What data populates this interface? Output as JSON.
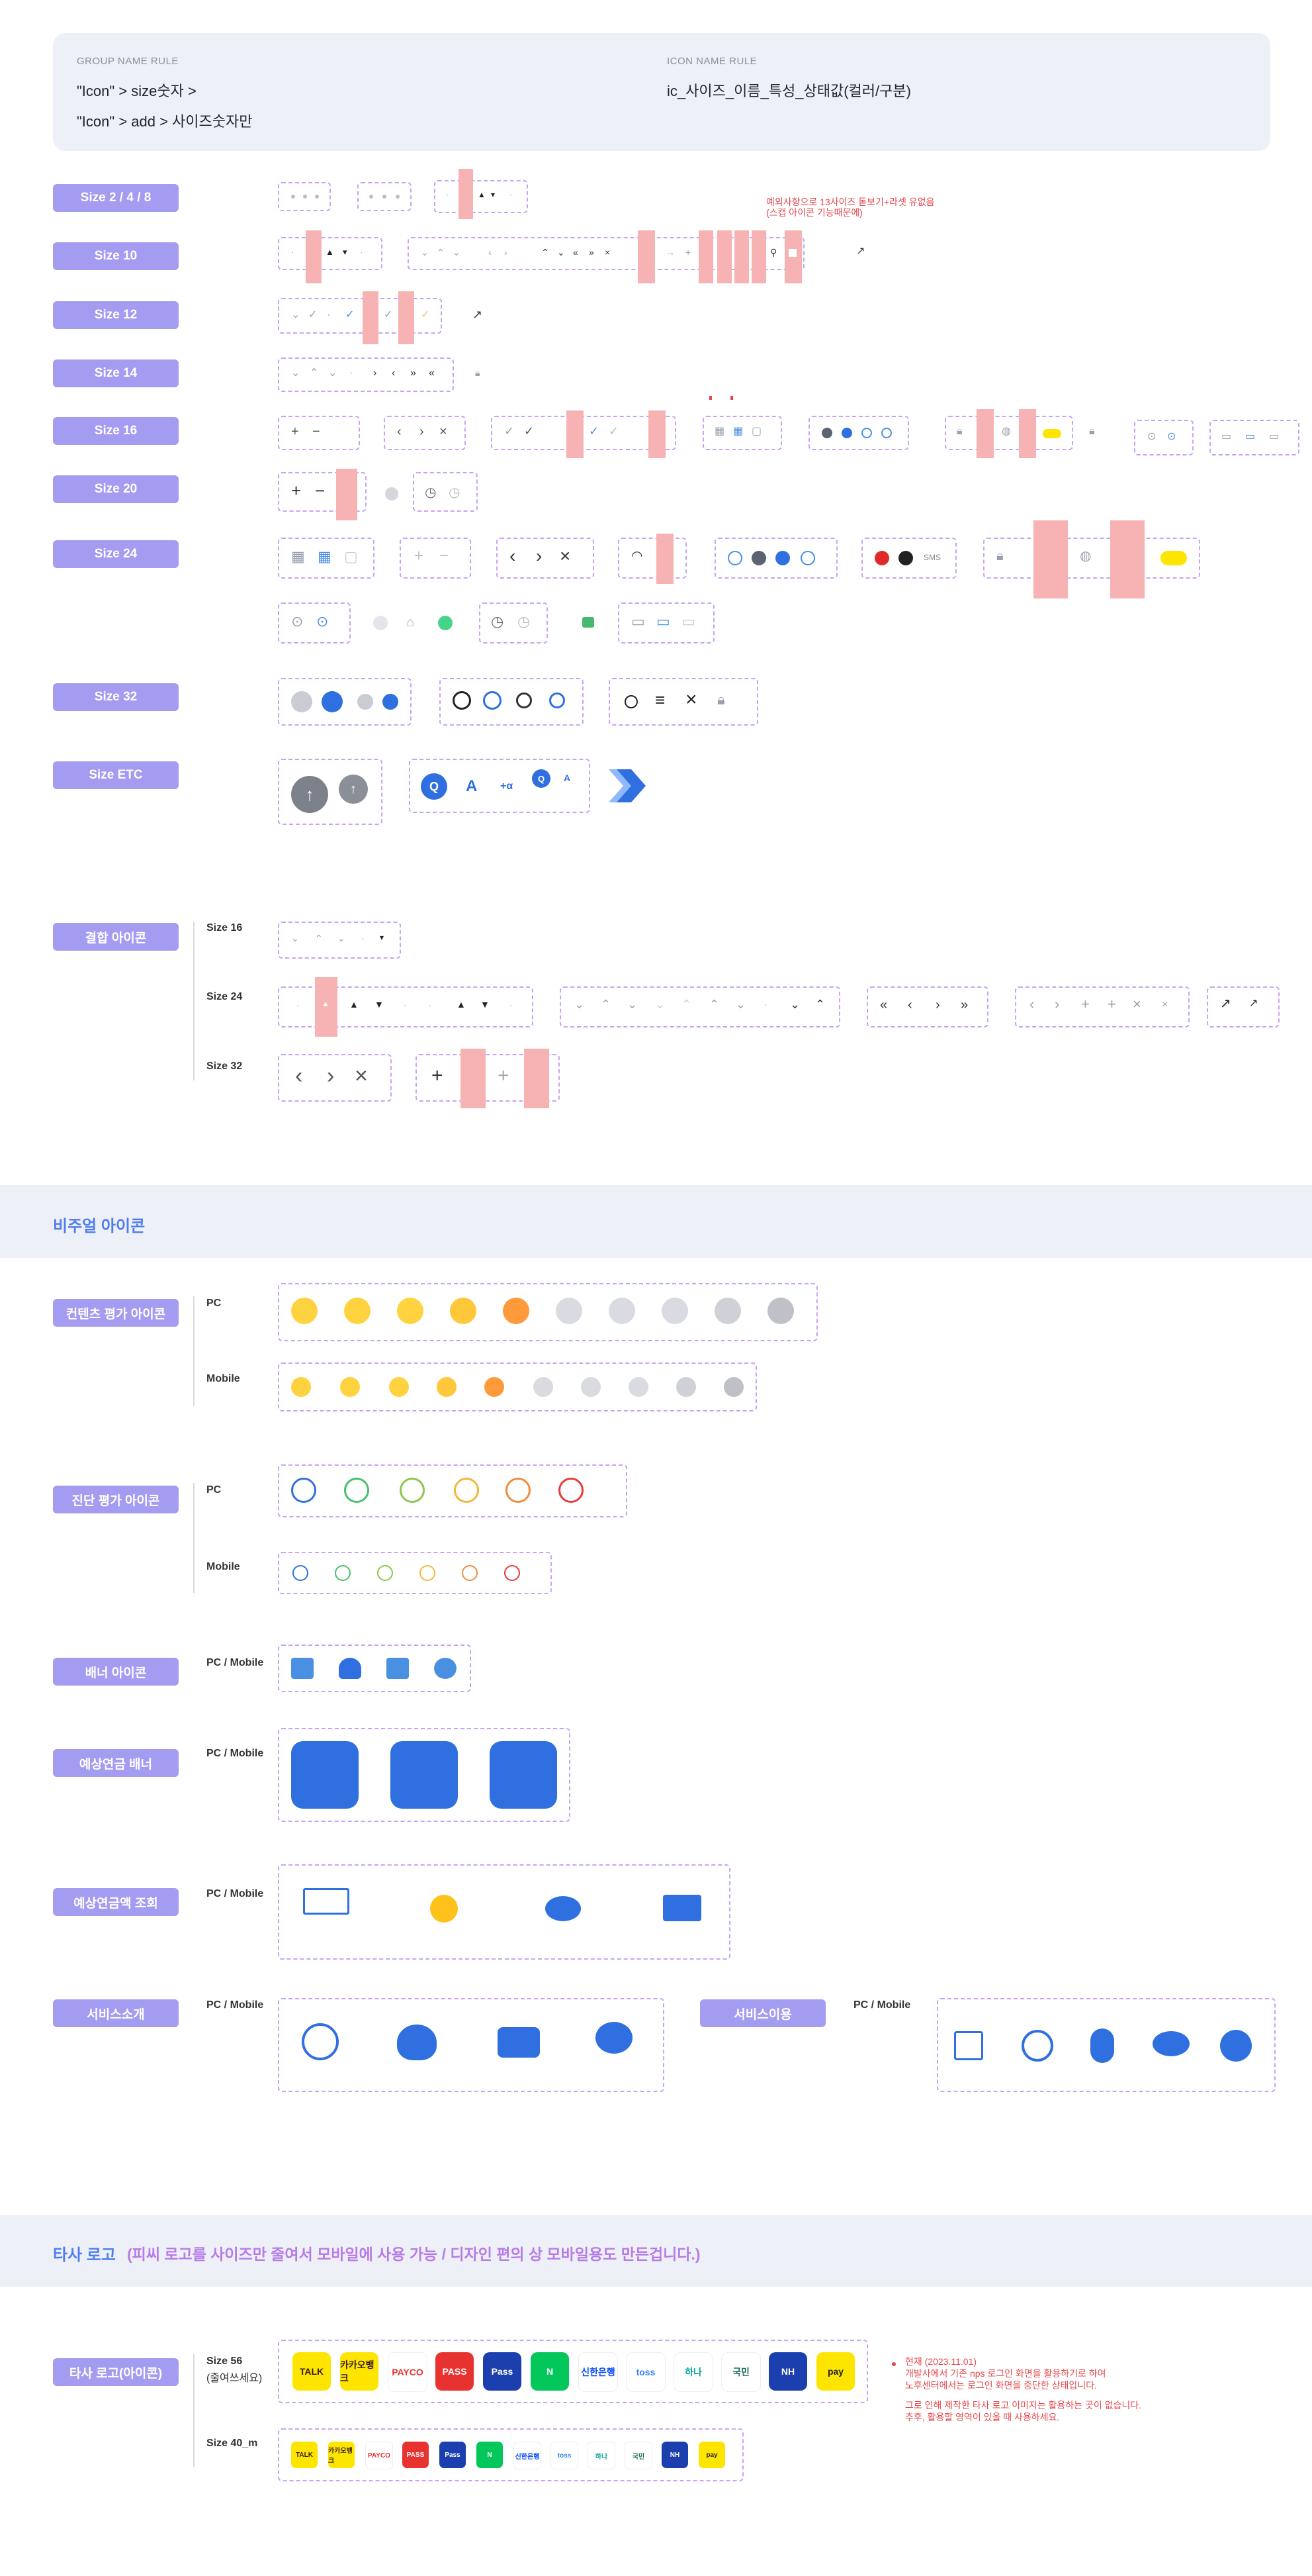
{
  "rules": {
    "group_label": "GROUP NAME RULE",
    "group_line1": "\"Icon\" > size숫자 >",
    "group_line2": "\"Icon\" > add > 사이즈숫자만",
    "icon_label": "ICON NAME RULE",
    "icon_rule": "ic_사이즈_이름_특성_상태값(컬러/구분)"
  },
  "sizes": {
    "s2": "Size 2 / 4 / 8",
    "s10": "Size 10",
    "s12": "Size 12",
    "s14": "Size 14",
    "s16": "Size 16",
    "s20": "Size 20",
    "s24": "Size 24",
    "s32": "Size 32",
    "setc": "Size ETC"
  },
  "size10_note_line1": "예외사항으로 13사이즈 돋보기+라셋 유없음",
  "size10_note_line2": "(스캡 아이콘 기능때문에)",
  "combo": {
    "title": "결합 아이콘",
    "s16": "Size 16",
    "s24": "Size 24",
    "s32": "Size 32"
  },
  "visual": {
    "band": "비주얼 아이콘",
    "content_rating": "컨텐츠 평가 아이콘",
    "diag_rating": "진단 평가 아이콘",
    "banner_icon": "배너 아이콘",
    "pension_banner": "예상연금 배너",
    "pension_query": "예상연금액 조회",
    "service_intro": "서비스소개",
    "service_use": "서비스이용",
    "pc": "PC",
    "mobile": "Mobile",
    "pc_mobile": "PC / Mobile"
  },
  "logos": {
    "band_title": "타사 로고",
    "band_sub": "(피씨 로고를 사이즈만 줄여서 모바일에 사용 가능 / 디자인 편의 상 모바일용도 만든겁니다.)",
    "pill": "타사 로고(아이콘)",
    "size56": "Size 56",
    "size56_sub": "(줄여쓰세요)",
    "size40": "Size 40_m",
    "note1": "현재 (2023.11.01)",
    "note2": "개발사에서 기존 nps 로그인 화면을 활용하기로 하여",
    "note3": "노후센터에서는 로그인 화면을 중단한 상태입니다.",
    "note4": "그로 인해 제작한 타사 로고 이미지는 활용하는 곳이 없습니다.",
    "note5": "추후, 활용할 영역이 있을 때 사용하세요.",
    "items": [
      {
        "name": "kakao",
        "text": "TALK",
        "bg": "#fee500",
        "fg": "#3c1e1e"
      },
      {
        "name": "kakaobank",
        "text": "카카오뱅크",
        "bg": "#fee500",
        "fg": "#3c1e1e"
      },
      {
        "name": "payco",
        "text": "PAYCO",
        "bg": "#ffffff",
        "fg": "#e8322f"
      },
      {
        "name": "pass-red",
        "text": "PASS",
        "bg": "#e8322f",
        "fg": "#ffffff"
      },
      {
        "name": "pass-blue",
        "text": "Pass",
        "bg": "#1b3fae",
        "fg": "#ffffff"
      },
      {
        "name": "naver",
        "text": "N",
        "bg": "#03c75a",
        "fg": "#ffffff"
      },
      {
        "name": "shinhan",
        "text": "신한은행",
        "bg": "#ffffff",
        "fg": "#0046ff"
      },
      {
        "name": "toss",
        "text": "toss",
        "bg": "#ffffff",
        "fg": "#3182f6"
      },
      {
        "name": "hana",
        "text": "하나",
        "bg": "#ffffff",
        "fg": "#00a69c"
      },
      {
        "name": "kb",
        "text": "국민",
        "bg": "#ffffff",
        "fg": "#1c6e5b"
      },
      {
        "name": "nh",
        "text": "NH",
        "bg": "#1b3fae",
        "fg": "#ffffff"
      },
      {
        "name": "kakaopay",
        "text": "pay",
        "bg": "#fee500",
        "fg": "#222222"
      }
    ]
  }
}
